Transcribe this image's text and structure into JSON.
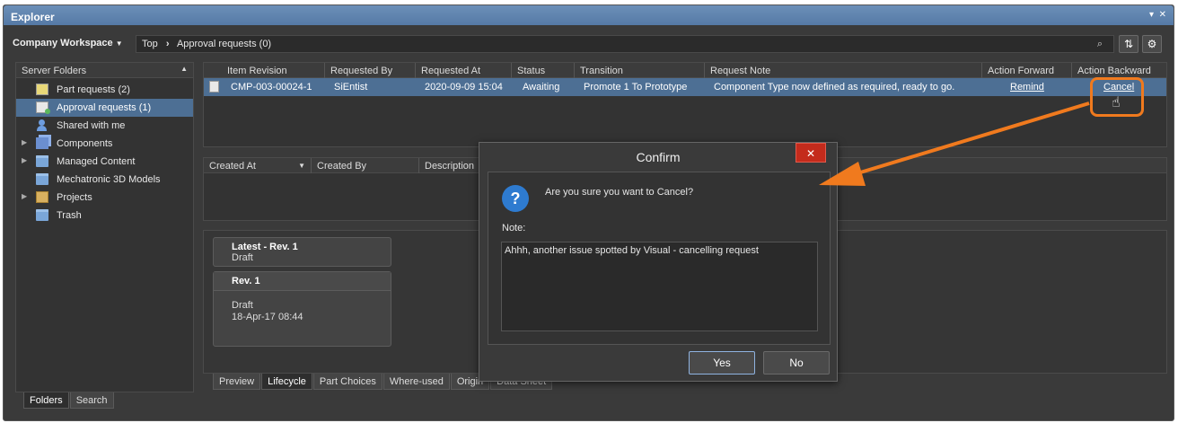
{
  "window": {
    "title": "Explorer",
    "pin_glyph": "▾",
    "close_glyph": "✕"
  },
  "toolbar": {
    "workspace_label": "Company Workspace",
    "breadcrumbs": [
      "Top",
      "Approval requests (0)"
    ],
    "crumb_separator": "›",
    "search_icon": "⌕",
    "refresh_icon": "⇅",
    "settings_icon": "⚙"
  },
  "sidebar": {
    "header": "Server Folders",
    "items": [
      {
        "label": "Part requests (2)",
        "icon": "doc-add-icon"
      },
      {
        "label": "Approval requests (1)",
        "icon": "doc-check-icon",
        "selected": true
      },
      {
        "label": "Shared with me",
        "icon": "person-icon"
      },
      {
        "label": "Components",
        "icon": "components-icon",
        "expandable": true
      },
      {
        "label": "Managed Content",
        "icon": "folder-icon",
        "expandable": true
      },
      {
        "label": "Mechatronic 3D Models",
        "icon": "folder-icon"
      },
      {
        "label": "Projects",
        "icon": "projects-icon",
        "expandable": true
      },
      {
        "label": "Trash",
        "icon": "folder-icon"
      }
    ],
    "bottom_tabs": [
      "Folders",
      "Search"
    ]
  },
  "requests_table": {
    "columns": [
      "Item Revision",
      "Requested By",
      "Requested At",
      "Status",
      "Transition",
      "Request Note",
      "Action Forward",
      "Action Backward"
    ],
    "rows": [
      {
        "item_revision": "CMP-003-00024-1",
        "requested_by": "SiEntist",
        "requested_at": "2020-09-09 15:04",
        "status": "Awaiting",
        "transition": "Promote 1 To Prototype",
        "request_note": "Component Type now defined as required, ready to go.",
        "action_forward": "Remind",
        "action_backward": "Cancel"
      }
    ]
  },
  "history_table": {
    "columns": [
      "Created At",
      "Created By",
      "Description"
    ]
  },
  "lifecycle": {
    "latest": {
      "title": "Latest - Rev.  1",
      "state": "Draft"
    },
    "rev": {
      "title": "Rev. 1",
      "state": "Draft",
      "date": "18-Apr-17 08:44"
    }
  },
  "bottom_tabs": [
    "Preview",
    "Lifecycle",
    "Part Choices",
    "Where-used",
    "Origin",
    "Data Sheet"
  ],
  "dialog": {
    "title": "Confirm",
    "close_glyph": "✕",
    "question_glyph": "?",
    "message": "Are you sure you want to Cancel?",
    "note_label": "Note:",
    "note_value": "Ahhh, another issue spotted by Visual - cancelling request",
    "yes_label": "Yes",
    "no_label": "No"
  },
  "colors": {
    "selection": "#4d6f94",
    "annotation": "#f07a1e",
    "title_bar": "#5f84ae",
    "close_red": "#c42b1c"
  }
}
